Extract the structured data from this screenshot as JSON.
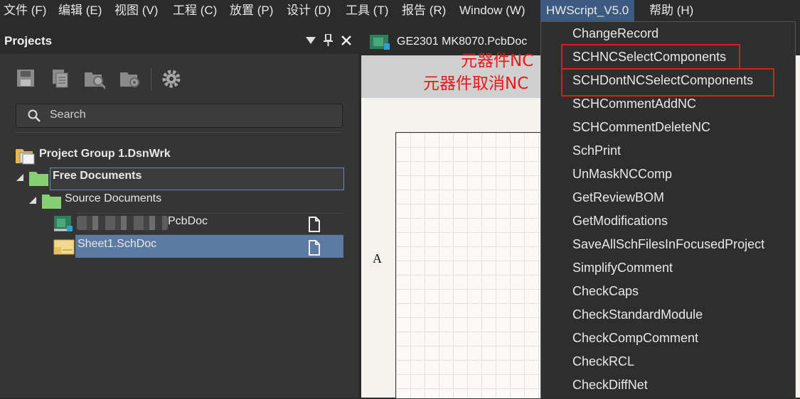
{
  "menubar": {
    "items": [
      {
        "label": "文件 (F)"
      },
      {
        "label": "编辑 (E)"
      },
      {
        "label": "视图 (V)"
      },
      {
        "label": "工程 (C)"
      },
      {
        "label": "放置 (P)"
      },
      {
        "label": "设计 (D)"
      },
      {
        "label": "工具 (T)"
      },
      {
        "label": "报告 (R)"
      },
      {
        "label": "Window (W)"
      },
      {
        "label": "HWScript_V5.0"
      },
      {
        "label": "帮助 (H)"
      }
    ]
  },
  "projects_panel": {
    "title": "Projects",
    "search_placeholder": "Search",
    "tree": {
      "group": "Project Group 1.DsnWrk",
      "free_documents": "Free Documents",
      "source_documents": "Source Documents",
      "pcb_doc": "PcbDoc",
      "sch_doc": "Sheet1.SchDoc"
    }
  },
  "editor": {
    "tab_label": "GE2301 MK8070.PcbDoc",
    "sheet_zone_letter": "A"
  },
  "hwscript_menu": {
    "items": [
      "ChangeRecord",
      "SCHNCSelectComponents",
      "SCHDontNCSelectComponents",
      "SCHCommentAddNC",
      "SCHCommentDeleteNC",
      "SchPrint",
      "UnMaskNCComp",
      "GetReviewBOM",
      "GetModifications",
      "SaveAllSchFilesInFocusedProject",
      "SimplifyComment",
      "CheckCaps",
      "CheckStandardModule",
      "CheckCompComment",
      "CheckRCL",
      "CheckDiffNet"
    ]
  },
  "annotations": {
    "nc_label": "元器件NC",
    "cancel_nc_label": "元器件取消NC"
  },
  "colors": {
    "highlight_box": "#e01919",
    "annotation_text": "#e51a1a",
    "active_menu": "#3d5a80",
    "selected_row": "#5c7ba3"
  }
}
